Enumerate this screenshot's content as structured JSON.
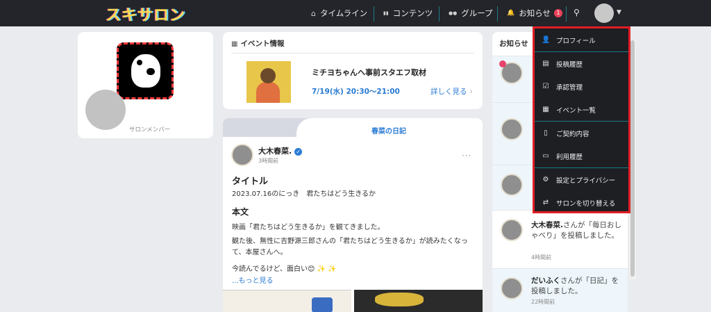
{
  "header": {
    "logo": "スキサロン",
    "nav": [
      {
        "label": "タイムライン",
        "icon": "home-icon",
        "glyph": "⌂"
      },
      {
        "label": "コンテンツ",
        "icon": "book-icon",
        "glyph": "▮▮"
      },
      {
        "label": "グループ",
        "icon": "users-icon",
        "glyph": "●●"
      },
      {
        "label": "お知らせ",
        "icon": "bell-icon",
        "glyph": "🔔",
        "badge": "1"
      }
    ],
    "search_glyph": "⚲",
    "caret_glyph": "▼"
  },
  "profile": {
    "member_label": "サロンメンバー"
  },
  "event": {
    "section_title": "イベント情報",
    "name": "ミチヨちゃんへ事前スタエフ取材",
    "date": "7/19(水) 20:30〜21:00",
    "more_label": "詳しく見る",
    "chev": "›"
  },
  "diary": {
    "tab_label": "春菜の日記",
    "author": "大木春菜.",
    "verified_glyph": "✓",
    "time": "3時間前",
    "menu_glyph": "···",
    "title": "タイトル",
    "subtitle": "2023.07.16のにっき　君たちはどう生きるか",
    "body_heading": "本文",
    "p1": "映画「君たちはどう生きるか」を観てきました。",
    "p2": "観た後、無性に吉野源三郎さんの「君たちはどう生きるか」が読みたくなって、本屋さんへ。",
    "p3": "今読んでるけど、面白い😊 ✨ ✨",
    "more_label": "...もっと見る"
  },
  "notices": {
    "heading": "お知らせ",
    "items": [
      {
        "author": "大木春菜.",
        "text": "さんが「毎日おしゃべり」を投稿しました。",
        "time": "4時間前"
      },
      {
        "author": "だいふく",
        "text": "さんが「日記」を投稿しました。",
        "time": "22時間前"
      }
    ]
  },
  "dropdown": {
    "items": [
      {
        "label": "プロフィール",
        "icon": "user-icon",
        "glyph": "👤"
      },
      {
        "label": "投稿履歴",
        "icon": "list-icon",
        "glyph": "▤"
      },
      {
        "label": "承認管理",
        "icon": "checkbox-icon",
        "glyph": "☑"
      },
      {
        "label": "イベント一覧",
        "icon": "calendar-icon",
        "glyph": "▦"
      },
      {
        "label": "ご契約内容",
        "icon": "clipboard-icon",
        "glyph": "▯"
      },
      {
        "label": "利用履歴",
        "icon": "credit-card-icon",
        "glyph": "▭"
      },
      {
        "label": "設定とプライバシー",
        "icon": "gear-icon",
        "glyph": "⚙"
      },
      {
        "label": "サロンを切り替える",
        "icon": "swap-icon",
        "glyph": "⇄"
      }
    ]
  }
}
